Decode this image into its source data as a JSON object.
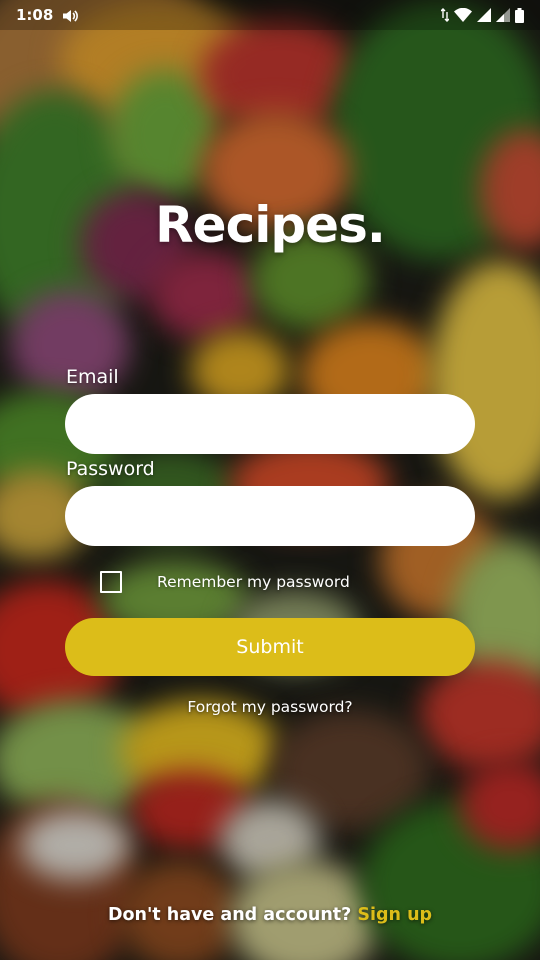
{
  "status_bar": {
    "time": "1:08",
    "icons": [
      "volume-icon",
      "data-arrows-icon",
      "wifi-icon",
      "signal-icon",
      "signal-icon",
      "battery-icon"
    ]
  },
  "app": {
    "title": "Recipes."
  },
  "form": {
    "email_label": "Email",
    "email_value": "",
    "password_label": "Password",
    "password_value": "",
    "remember_label": "Remember my password",
    "remember_checked": false,
    "submit_label": "Submit",
    "forgot_label": "Forgot my password?"
  },
  "footer": {
    "prompt": "Don't have and account?",
    "signup_label": "Sign up"
  },
  "colors": {
    "accent": "#dcbd19",
    "field_bg": "#ffffff",
    "text": "#ffffff"
  }
}
